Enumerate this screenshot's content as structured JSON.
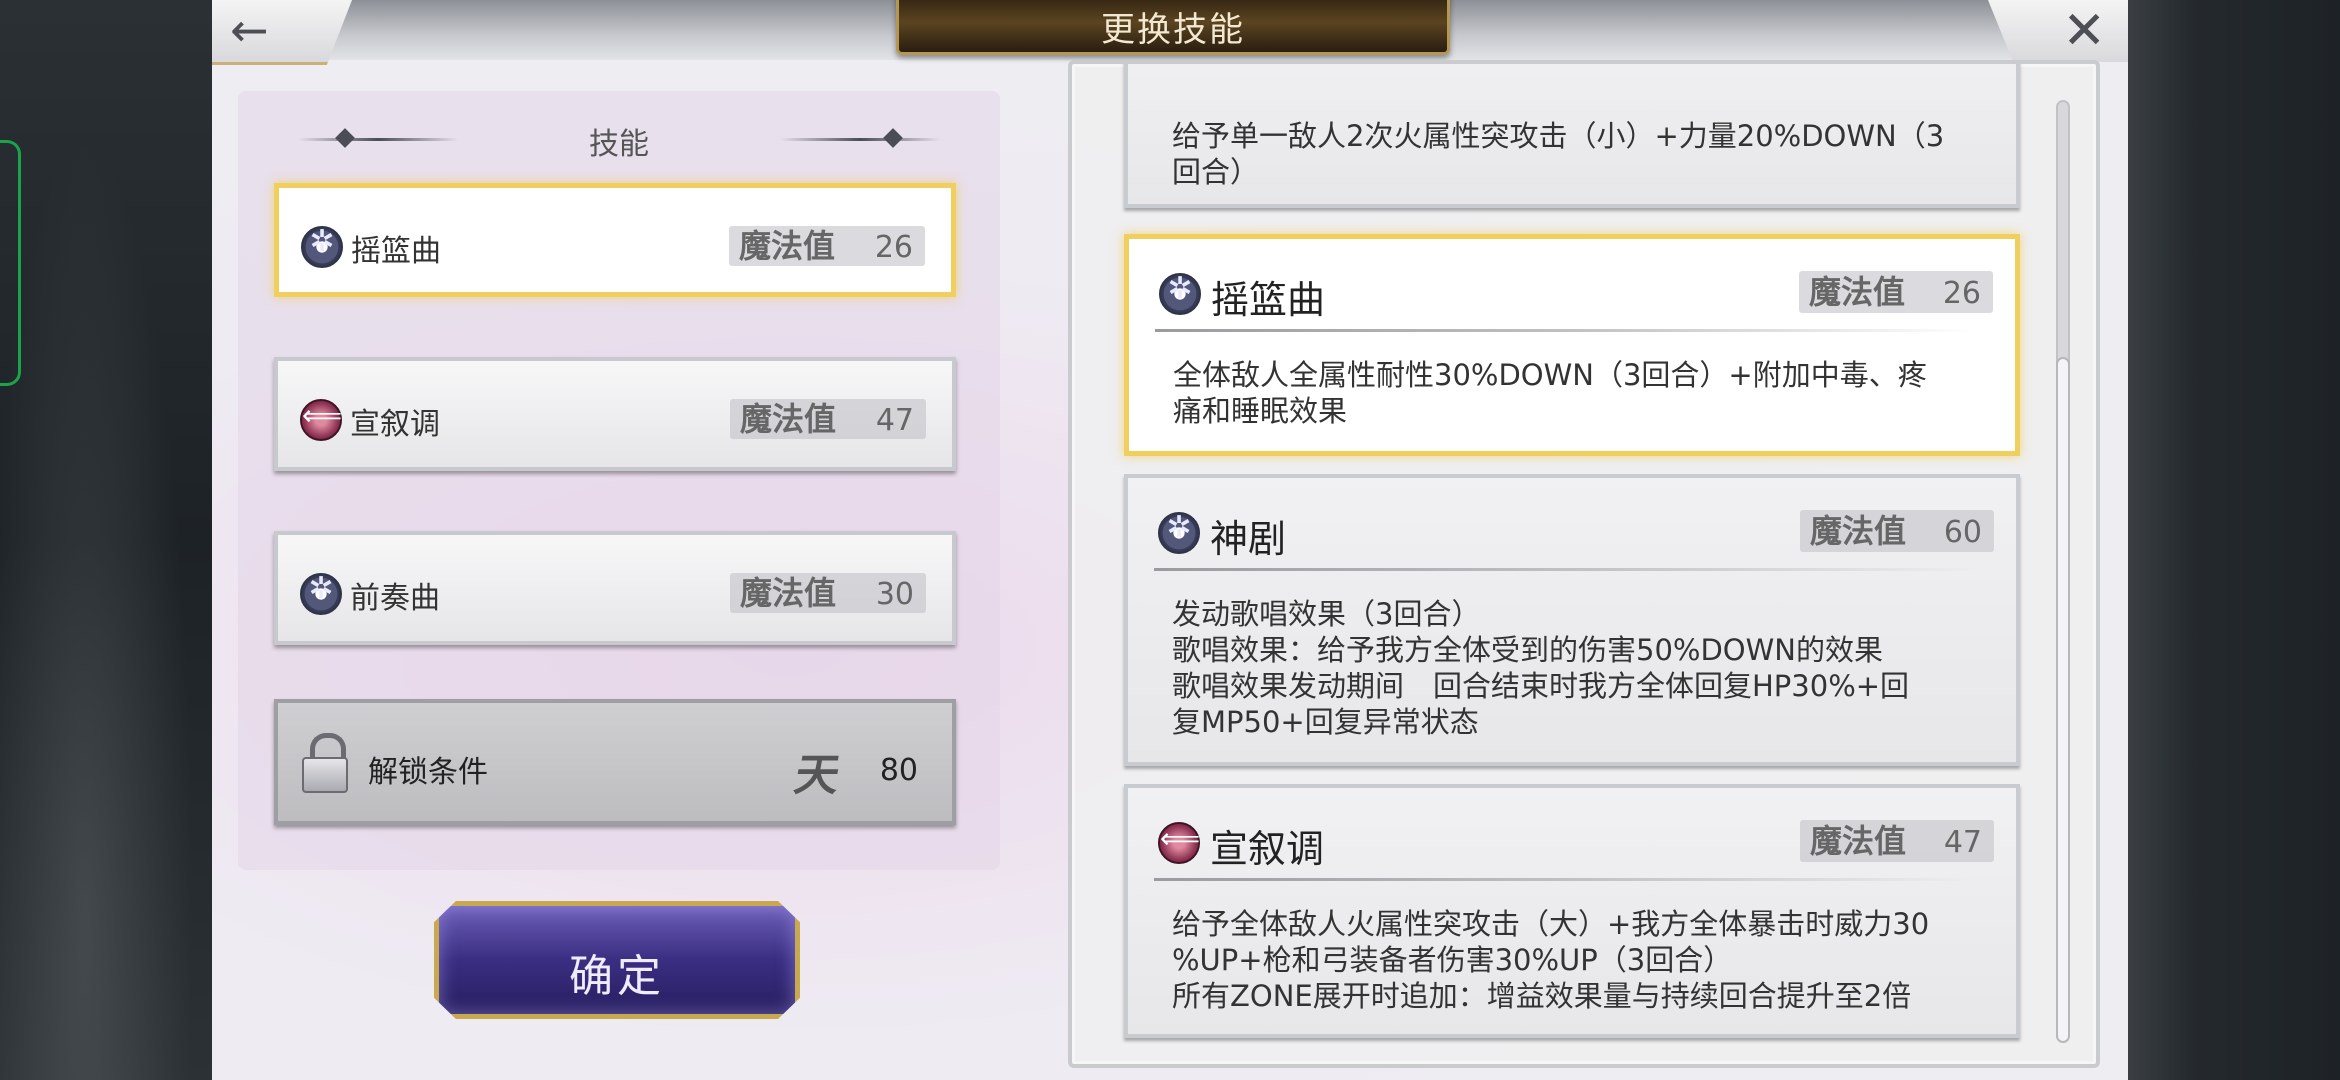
{
  "header": {
    "title": "更换技能",
    "back_icon": "←",
    "close_icon": "✕"
  },
  "left": {
    "section_title": "技能",
    "skills": [
      {
        "name": "摇篮曲",
        "mp_label": "魔法值",
        "mp": "26",
        "icon": "star-emblem-icon",
        "selected": true
      },
      {
        "name": "宣叙调",
        "mp_label": "魔法值",
        "mp": "47",
        "icon": "arrow-emblem-icon",
        "selected": false
      },
      {
        "name": "前奏曲",
        "mp_label": "魔法值",
        "mp": "30",
        "icon": "star-emblem-icon",
        "selected": false
      }
    ],
    "locked": {
      "label": "解锁条件",
      "rank_glyph": "天",
      "value": "80",
      "icon": "lock-icon"
    },
    "confirm_label": "确定"
  },
  "details": [
    {
      "partial": true,
      "lines": [
        "给予单一敌人2次火属性突攻击（小）+力量20%DOWN（3",
        "回合）"
      ]
    },
    {
      "name": "摇篮曲",
      "mp_label": "魔法值",
      "mp": "26",
      "icon": "star-emblem-icon",
      "selected": true,
      "lines": [
        "全体敌人全属性耐性30%DOWN（3回合）+附加中毒、疼",
        "痛和睡眠效果"
      ]
    },
    {
      "name": "神剧",
      "mp_label": "魔法值",
      "mp": "60",
      "icon": "star-emblem-icon",
      "selected": false,
      "lines": [
        "发动歌唱效果（3回合）",
        "歌唱效果：给予我方全体受到的伤害50%DOWN的效果",
        "歌唱效果发动期间　回合结束时我方全体回复HP30%+回",
        "复MP50+回复异常状态"
      ]
    },
    {
      "name": "宣叙调",
      "mp_label": "魔法值",
      "mp": "47",
      "icon": "arrow-emblem-icon",
      "selected": false,
      "lines": [
        "给予全体敌人火属性突攻击（大）+我方全体暴击时威力30",
        "%UP+枪和弓装备者伤害30%UP（3回合）",
        "所有ZONE展开时追加：增益效果量与持续回合提升至2倍"
      ]
    }
  ]
}
